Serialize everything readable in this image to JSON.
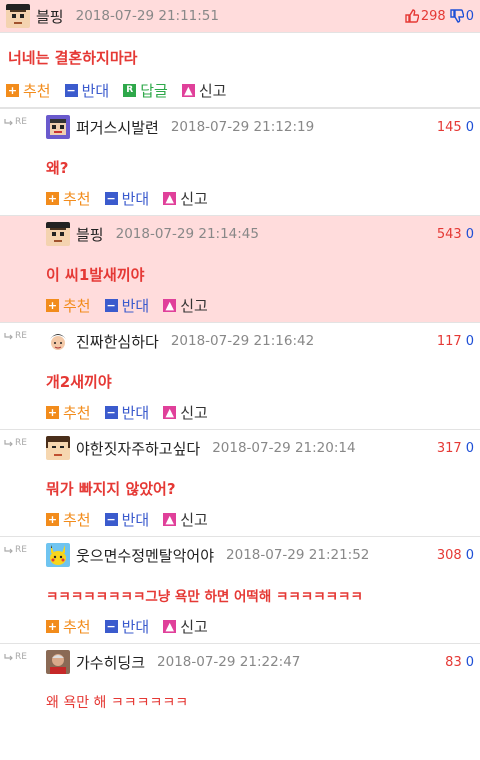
{
  "actions": {
    "recommend": "추천",
    "oppose": "반대",
    "reply": "답글",
    "report": "신고"
  },
  "re_label": "RE",
  "colors": {
    "up": "#e53935",
    "down": "#1e4fd6",
    "highlight": "#ffdcdc"
  },
  "top": {
    "author": "블핑",
    "date": "2018-07-29 21:11:51",
    "up": "298",
    "down": "0",
    "text": "너네는 결혼하지마라",
    "up_icon": "thumbs-up-icon",
    "down_icon": "thumbs-down-icon"
  },
  "replies": [
    {
      "author": "퍼거스시발련",
      "date": "2018-07-29 21:12:19",
      "up": "145",
      "down": "0",
      "text": "왜?",
      "avatar": "pixel-pirate-avatar"
    },
    {
      "author": "블핑",
      "date": "2018-07-29 21:14:45",
      "up": "543",
      "down": "0",
      "text": "이 씨1발새끼야",
      "avatar": "pixel-graduate-avatar"
    },
    {
      "author": "진짜한심하다",
      "date": "2018-07-29 21:16:42",
      "up": "117",
      "down": "0",
      "text": "개2새끼야",
      "avatar": "cartoon-avatar"
    },
    {
      "author": "야한짓자주하고싶다",
      "date": "2018-07-29 21:20:14",
      "up": "317",
      "down": "0",
      "text": "뭐가 빠지지 않았어?",
      "avatar": "pixel-face-avatar"
    },
    {
      "author": "웃으면수정멘탈악어야",
      "date": "2018-07-29 21:21:52",
      "up": "308",
      "down": "0",
      "text": "ㅋㅋㅋㅋㅋㅋㅋㅋ그냥 욕만 하면 어떡해 ㅋㅋㅋㅋㅋㅋㅋ",
      "avatar": "pikachu-avatar"
    },
    {
      "author": "가수히딩크",
      "date": "2018-07-29 21:22:47",
      "up": "83",
      "down": "0",
      "text": "왜 욕만 해 ㅋㅋㅋㅋㅋㅋ",
      "avatar": "photo-avatar"
    }
  ]
}
